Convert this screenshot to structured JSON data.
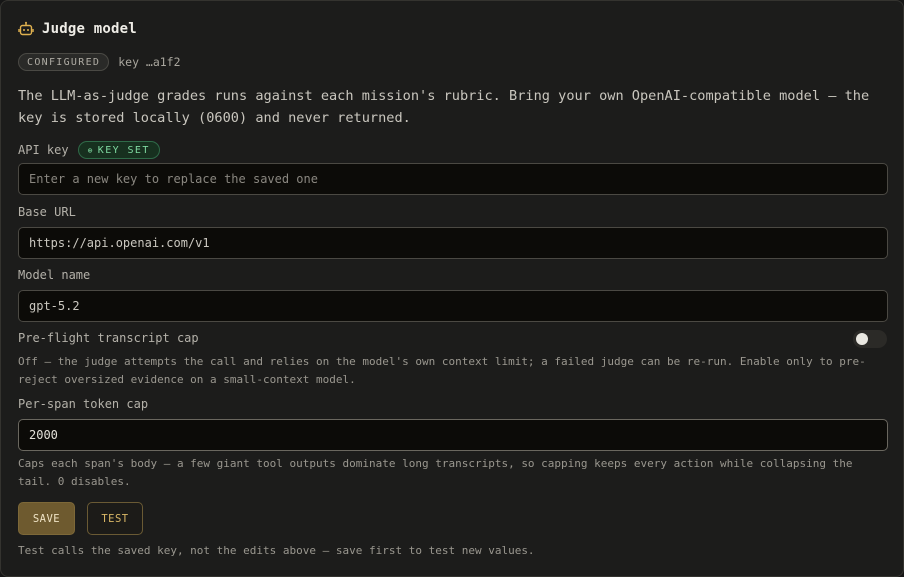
{
  "header": {
    "title": "Judge model",
    "icon": "robot-icon",
    "icon_color": "#e0b14f"
  },
  "status": {
    "badge": "CONFIGURED",
    "key_hint": "key …a1f2"
  },
  "description": "The LLM-as-judge grades runs against each mission's rubric. Bring your own OpenAI-compatible model — the key is stored locally (0600) and never returned.",
  "api_key": {
    "label": "API key",
    "badge": "KEY SET",
    "badge_icon": "⊕",
    "placeholder": "Enter a new key to replace the saved one"
  },
  "base_url": {
    "label": "Base URL",
    "value": "https://api.openai.com/v1"
  },
  "model_name": {
    "label": "Model name",
    "value": "gpt-5.2"
  },
  "preflight": {
    "label": "Pre-flight transcript cap",
    "enabled": false,
    "help": "Off — the judge attempts the call and relies on the model's own context limit; a failed judge can be re-run. Enable only to pre-reject oversized evidence on a small-context model."
  },
  "token_cap": {
    "label": "Per-span token cap",
    "value": "2000",
    "help": "Caps each span's body — a few giant tool outputs dominate long transcripts, so capping keeps every action while collapsing the tail. 0 disables."
  },
  "actions": {
    "save_label": "SAVE",
    "test_label": "TEST"
  },
  "footer_note": "Test calls the saved key, not the edits above — save first to test new values."
}
